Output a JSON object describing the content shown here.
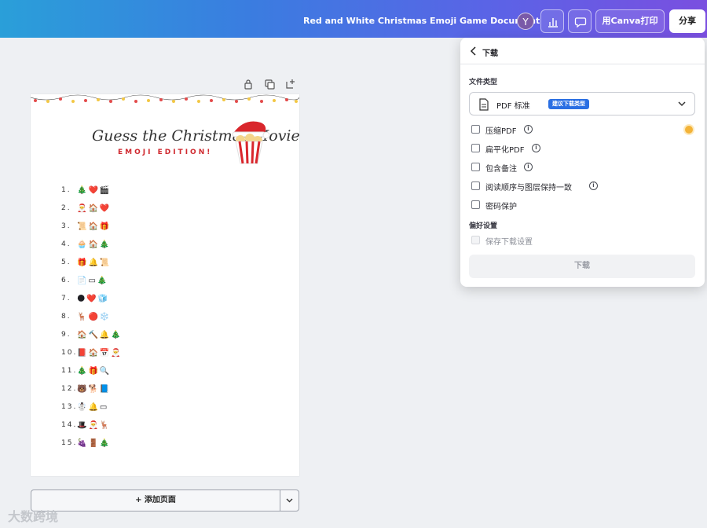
{
  "header": {
    "doc_title": "Red and White Christmas Emoji Game Document",
    "avatar_letter": "Y",
    "print_label": "用Canva打印",
    "share_label": "分享"
  },
  "document": {
    "title": "Guess the Christmas Movie",
    "subtitle": "EMOJI EDITION!",
    "items": [
      {
        "num": "1.",
        "emoji": "🎄❤️🎬"
      },
      {
        "num": "2.",
        "emoji": "🎅🏠❤️"
      },
      {
        "num": "3.",
        "emoji": "📜🏠🎁"
      },
      {
        "num": "4.",
        "emoji": "🧁🏠🎄"
      },
      {
        "num": "5.",
        "emoji": "🎁🔔📜"
      },
      {
        "num": "6.",
        "emoji": "📄▭🎄"
      },
      {
        "num": "7.",
        "emoji": "🌑❤️🧊"
      },
      {
        "num": "8.",
        "emoji": "🦌🔴❄️"
      },
      {
        "num": "9.",
        "emoji": "🏠🔨🔔🎄"
      },
      {
        "num": "10.",
        "emoji": "📕🏠📅🎅"
      },
      {
        "num": "11.",
        "emoji": "🎄🎁🔍"
      },
      {
        "num": "12.",
        "emoji": "🐻🐕📘"
      },
      {
        "num": "13.",
        "emoji": "☃️🔔▭"
      },
      {
        "num": "14.",
        "emoji": "🎩🎅🦌"
      },
      {
        "num": "15.",
        "emoji": "🍇🚪🎄"
      }
    ],
    "add_page_label": "+ 添加页面"
  },
  "watermark": "大数跨境",
  "download_panel": {
    "title": "下载",
    "file_type_label": "文件类型",
    "file_type_value": "PDF 标准",
    "file_type_badge": "建议下载类型",
    "options": [
      {
        "label": "压缩PDF",
        "info": true
      },
      {
        "label": "扁平化PDF",
        "info": true
      },
      {
        "label": "包含备注",
        "info": true
      },
      {
        "label": "阅读顺序与图层保持一致",
        "info": true
      },
      {
        "label": "密码保护",
        "info": false
      }
    ],
    "preferences_label": "偏好设置",
    "save_settings_label": "保存下载设置",
    "download_button": "下载"
  },
  "colors": {
    "accent": "#2a6fe3",
    "title_red": "#d0292f",
    "pro_badge": "#f3b338"
  }
}
